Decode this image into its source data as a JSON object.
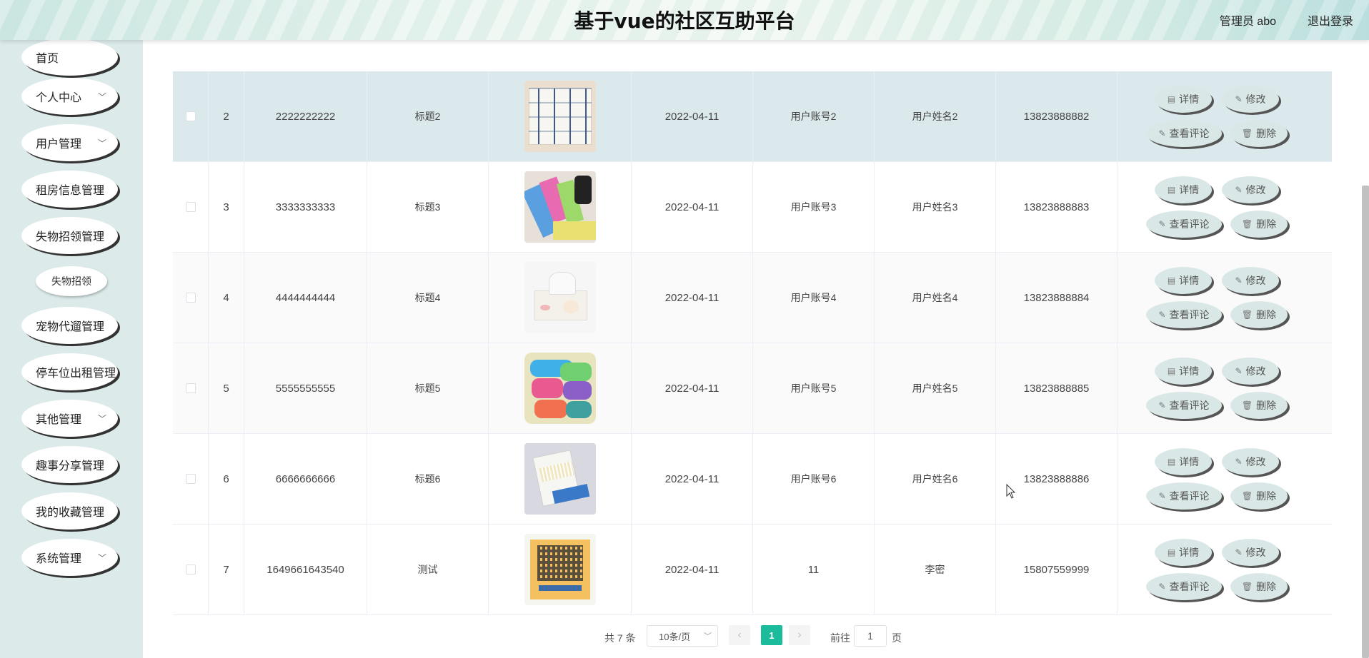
{
  "header": {
    "title": "基于vue的社区互助平台",
    "user": "管理员 abo",
    "logout": "退出登录"
  },
  "sidebar": {
    "items": [
      {
        "label": "首页"
      },
      {
        "label": "个人中心",
        "chevron": "chevron-down-icon"
      },
      {
        "label": "用户管理",
        "chevron": "chevron-down-icon"
      },
      {
        "label": "租房信息管理"
      },
      {
        "label": "失物招领管理"
      },
      {
        "label": "宠物代遛管理"
      },
      {
        "label": "停车位出租管理"
      },
      {
        "label": "其他管理",
        "chevron": "chevron-down-icon"
      },
      {
        "label": "趣事分享管理"
      },
      {
        "label": "我的收藏管理"
      },
      {
        "label": "系统管理",
        "chevron": "chevron-down-icon"
      }
    ],
    "sub_items": [
      {
        "label": "失物招领"
      }
    ]
  },
  "table": {
    "actions": {
      "detail": "详情",
      "edit": "修改",
      "comments": "查看评论",
      "delete": "删除"
    },
    "rows": [
      {
        "index": "2",
        "number": "2222222222",
        "title": "标题2",
        "date": "2022-04-11",
        "account": "用户账号2",
        "name": "用户姓名2",
        "phone": "13823888882",
        "image": "toilet-paper-pack"
      },
      {
        "index": "3",
        "number": "3333333333",
        "title": "标题3",
        "date": "2022-04-11",
        "account": "用户账号3",
        "name": "用户姓名3",
        "phone": "13823888883",
        "image": "garbage-bags"
      },
      {
        "index": "4",
        "number": "4444444444",
        "title": "标题4",
        "date": "2022-04-11",
        "account": "用户账号4",
        "name": "用户姓名4",
        "phone": "13823888884",
        "image": "tissue-box"
      },
      {
        "index": "5",
        "number": "5555555555",
        "title": "标题5",
        "date": "2022-04-11",
        "account": "用户账号5",
        "name": "用户姓名5",
        "phone": "13823888885",
        "image": "towels"
      },
      {
        "index": "6",
        "number": "6666666666",
        "title": "标题6",
        "date": "2022-04-11",
        "account": "用户账号6",
        "name": "用户姓名6",
        "phone": "13823888886",
        "image": "cotton-swabs"
      },
      {
        "index": "7",
        "number": "1649661643540",
        "title": "测试",
        "date": "2022-04-11",
        "account": "11",
        "name": "李密",
        "phone": "15807559999",
        "image": "qr-code"
      }
    ]
  },
  "pagination": {
    "total": "共 7 条",
    "page_size": "10条/页",
    "current": "1",
    "goto": "前往",
    "goto_value": "1",
    "unit": "页"
  },
  "colors": {
    "accent": "#1abc9c",
    "sidebar_bg": "#dcebea",
    "button_bg": "#d9e8e6",
    "highlight_row": "#dce9ec"
  }
}
